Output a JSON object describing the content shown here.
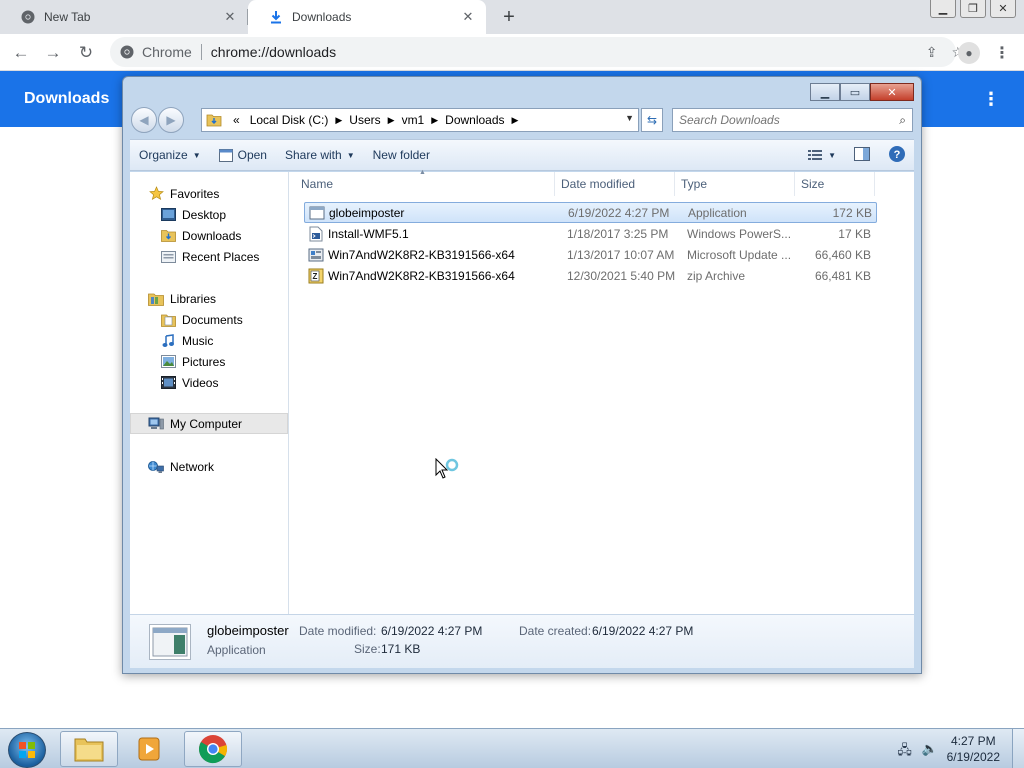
{
  "browser": {
    "tabs": [
      {
        "title": "New Tab",
        "icon": "chrome-icon"
      },
      {
        "title": "Downloads",
        "icon": "download-icon"
      }
    ],
    "omnibox": {
      "site_name": "Chrome",
      "url": "chrome://downloads"
    },
    "accent": "#1a73e8"
  },
  "downloads_page": {
    "title": "Downloads"
  },
  "explorer": {
    "breadcrumb": [
      "Local Disk (C:)",
      "Users",
      "vm1",
      "Downloads"
    ],
    "breadcrumb_prefix": "«",
    "search_placeholder": "Search Downloads",
    "commands": {
      "organize": "Organize",
      "open": "Open",
      "share_with": "Share with",
      "new_folder": "New folder"
    },
    "nav": {
      "favorites": "Favorites",
      "desktop": "Desktop",
      "downloads": "Downloads",
      "recent_places": "Recent Places",
      "libraries": "Libraries",
      "documents": "Documents",
      "music": "Music",
      "pictures": "Pictures",
      "videos": "Videos",
      "my_computer": "My Computer",
      "network": "Network"
    },
    "columns": {
      "name": "Name",
      "date_modified": "Date modified",
      "type": "Type",
      "size": "Size"
    },
    "files": [
      {
        "name": "globeimposter",
        "date": "6/19/2022 4:27 PM",
        "type": "Application",
        "size": "172 KB",
        "icon": "application-icon"
      },
      {
        "name": "Install-WMF5.1",
        "date": "1/18/2017 3:25 PM",
        "type": "Windows PowerS...",
        "size": "17 KB",
        "icon": "powershell-script-icon"
      },
      {
        "name": "Win7AndW2K8R2-KB3191566-x64",
        "date": "1/13/2017 10:07 AM",
        "type": "Microsoft Update ...",
        "size": "66,460 KB",
        "icon": "update-package-icon"
      },
      {
        "name": "Win7AndW2K8R2-KB3191566-x64",
        "date": "12/30/2021 5:40 PM",
        "type": "zip Archive",
        "size": "66,481 KB",
        "icon": "zip-archive-icon"
      }
    ],
    "details": {
      "name": "globeimposter",
      "type": "Application",
      "date_modified_label": "Date modified:",
      "date_modified": "6/19/2022 4:27 PM",
      "date_created_label": "Date created:",
      "date_created": "6/19/2022 4:27 PM",
      "size_label": "Size:",
      "size": "171 KB"
    }
  },
  "taskbar": {
    "time": "4:27 PM",
    "date": "6/19/2022"
  }
}
